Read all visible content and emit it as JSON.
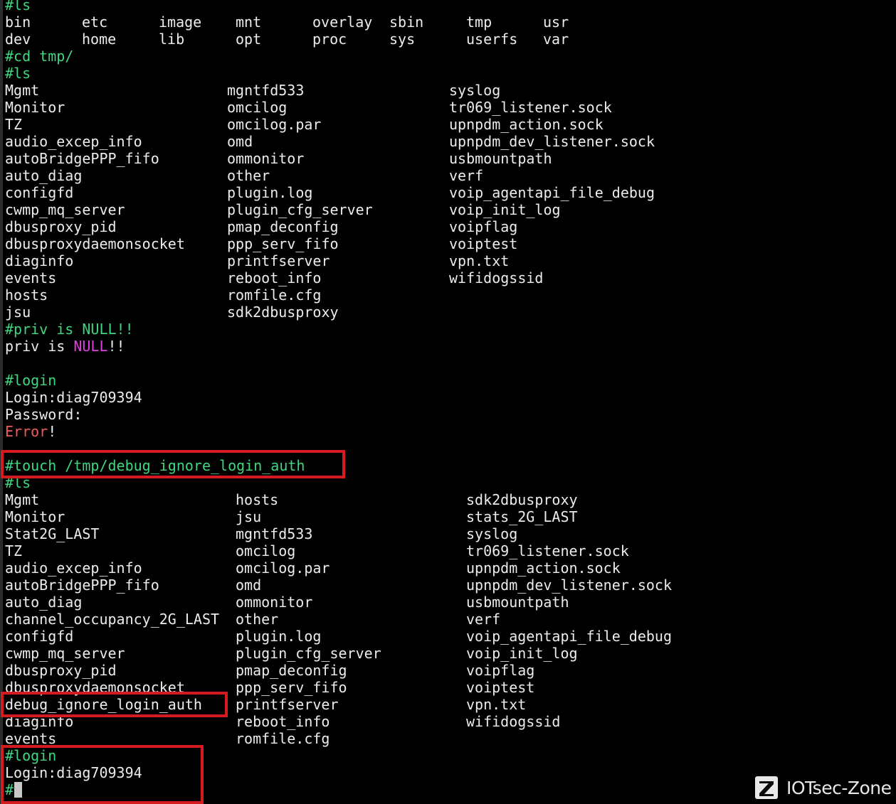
{
  "terminal": {
    "prompt": "#",
    "root_ls": {
      "command": "#ls",
      "rows": [
        [
          "bin",
          "etc",
          "image",
          "mnt",
          "overlay",
          "sbin",
          "tmp",
          "usr"
        ],
        [
          "dev",
          "home",
          "lib",
          "opt",
          "proc",
          "sys",
          "userfs",
          "var"
        ]
      ]
    },
    "cd_command": "#cd tmp/",
    "ls1": {
      "command": "#ls",
      "columns": [
        [
          "Mgmt",
          "Monitor",
          "TZ",
          "audio_excep_info",
          "autoBridgePPP_fifo",
          "auto_diag",
          "configfd",
          "cwmp_mq_server",
          "dbusproxy_pid",
          "dbusproxydaemonsocket",
          "diaginfo",
          "events",
          "hosts",
          "jsu"
        ],
        [
          "mgntfd533",
          "omcilog",
          "omcilog.par",
          "omd",
          "ommonitor",
          "other",
          "plugin.log",
          "plugin_cfg_server",
          "pmap_deconfig",
          "ppp_serv_fifo",
          "printfserver",
          "reboot_info",
          "romfile.cfg",
          "sdk2dbusproxy"
        ],
        [
          "syslog",
          "tr069_listener.sock",
          "upnpdm_action.sock",
          "upnpdm_dev_listener.sock",
          "usbmountpath",
          "verf",
          "voip_agentapi_file_debug",
          "voip_init_log",
          "voipflag",
          "voiptest",
          "vpn.txt",
          "wifidogssid"
        ]
      ]
    },
    "priv": {
      "command": "#priv is NULL!!",
      "out_prefix": "priv is ",
      "out_null": "NULL",
      "out_suffix": "!!"
    },
    "login1": {
      "command": "#login",
      "login_line": "Login:diag709394",
      "password_line": "Password:",
      "error_word": "Error",
      "error_suffix": "!"
    },
    "touch_command": "#touch /tmp/debug_ignore_login_auth",
    "ls2": {
      "command": "#ls",
      "columns": [
        [
          "Mgmt",
          "Monitor",
          "Stat2G_LAST",
          "TZ",
          "audio_excep_info",
          "autoBridgePPP_fifo",
          "auto_diag",
          "channel_occupancy_2G_LAST",
          "configfd",
          "cwmp_mq_server",
          "dbusproxy_pid",
          "dbusproxydaemonsocket",
          "debug_ignore_login_auth",
          "diaginfo",
          "events"
        ],
        [
          "hosts",
          "jsu",
          "mgntfd533",
          "omcilog",
          "omcilog.par",
          "omd",
          "ommonitor",
          "other",
          "plugin.log",
          "plugin_cfg_server",
          "pmap_deconfig",
          "ppp_serv_fifo",
          "printfserver",
          "reboot_info",
          "romfile.cfg"
        ],
        [
          "sdk2dbusproxy",
          "stats_2G_LAST",
          "syslog",
          "tr069_listener.sock",
          "upnpdm_action.sock",
          "upnpdm_dev_listener.sock",
          "usbmountpath",
          "verf",
          "voip_agentapi_file_debug",
          "voip_init_log",
          "voipflag",
          "voiptest",
          "vpn.txt",
          "wifidogssid"
        ]
      ]
    },
    "login2": {
      "command": "#login",
      "login_line": "Login:diag709394"
    }
  },
  "watermark": {
    "text": "IOTsec-Zone",
    "icon": "z-logo-icon"
  },
  "colors": {
    "background": "#000000",
    "text": "#ececec",
    "prompt": "#3fd67f",
    "null_highlight": "#e040e0",
    "error": "#f05b5b",
    "highlight_box": "#d41c20"
  }
}
